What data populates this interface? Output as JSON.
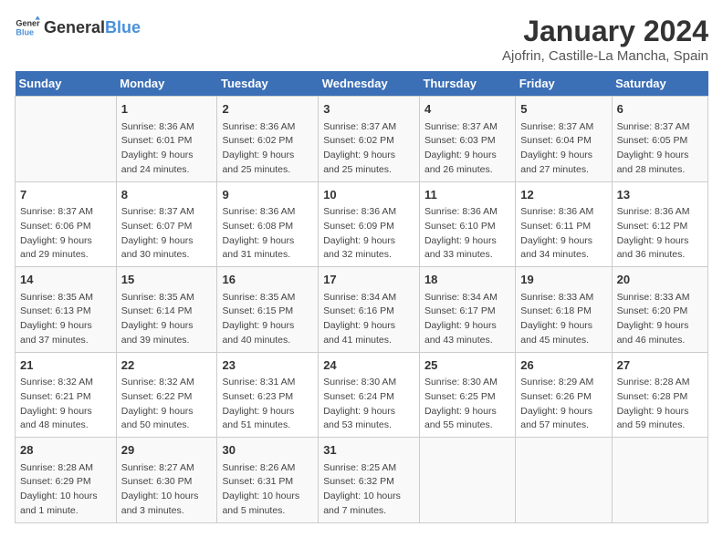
{
  "header": {
    "logo_general": "General",
    "logo_blue": "Blue",
    "title": "January 2024",
    "subtitle": "Ajofrin, Castille-La Mancha, Spain"
  },
  "columns": [
    "Sunday",
    "Monday",
    "Tuesday",
    "Wednesday",
    "Thursday",
    "Friday",
    "Saturday"
  ],
  "weeks": [
    [
      {
        "day": "",
        "lines": []
      },
      {
        "day": "1",
        "lines": [
          "Sunrise: 8:36 AM",
          "Sunset: 6:01 PM",
          "Daylight: 9 hours",
          "and 24 minutes."
        ]
      },
      {
        "day": "2",
        "lines": [
          "Sunrise: 8:36 AM",
          "Sunset: 6:02 PM",
          "Daylight: 9 hours",
          "and 25 minutes."
        ]
      },
      {
        "day": "3",
        "lines": [
          "Sunrise: 8:37 AM",
          "Sunset: 6:02 PM",
          "Daylight: 9 hours",
          "and 25 minutes."
        ]
      },
      {
        "day": "4",
        "lines": [
          "Sunrise: 8:37 AM",
          "Sunset: 6:03 PM",
          "Daylight: 9 hours",
          "and 26 minutes."
        ]
      },
      {
        "day": "5",
        "lines": [
          "Sunrise: 8:37 AM",
          "Sunset: 6:04 PM",
          "Daylight: 9 hours",
          "and 27 minutes."
        ]
      },
      {
        "day": "6",
        "lines": [
          "Sunrise: 8:37 AM",
          "Sunset: 6:05 PM",
          "Daylight: 9 hours",
          "and 28 minutes."
        ]
      }
    ],
    [
      {
        "day": "7",
        "lines": [
          "Sunrise: 8:37 AM",
          "Sunset: 6:06 PM",
          "Daylight: 9 hours",
          "and 29 minutes."
        ]
      },
      {
        "day": "8",
        "lines": [
          "Sunrise: 8:37 AM",
          "Sunset: 6:07 PM",
          "Daylight: 9 hours",
          "and 30 minutes."
        ]
      },
      {
        "day": "9",
        "lines": [
          "Sunrise: 8:36 AM",
          "Sunset: 6:08 PM",
          "Daylight: 9 hours",
          "and 31 minutes."
        ]
      },
      {
        "day": "10",
        "lines": [
          "Sunrise: 8:36 AM",
          "Sunset: 6:09 PM",
          "Daylight: 9 hours",
          "and 32 minutes."
        ]
      },
      {
        "day": "11",
        "lines": [
          "Sunrise: 8:36 AM",
          "Sunset: 6:10 PM",
          "Daylight: 9 hours",
          "and 33 minutes."
        ]
      },
      {
        "day": "12",
        "lines": [
          "Sunrise: 8:36 AM",
          "Sunset: 6:11 PM",
          "Daylight: 9 hours",
          "and 34 minutes."
        ]
      },
      {
        "day": "13",
        "lines": [
          "Sunrise: 8:36 AM",
          "Sunset: 6:12 PM",
          "Daylight: 9 hours",
          "and 36 minutes."
        ]
      }
    ],
    [
      {
        "day": "14",
        "lines": [
          "Sunrise: 8:35 AM",
          "Sunset: 6:13 PM",
          "Daylight: 9 hours",
          "and 37 minutes."
        ]
      },
      {
        "day": "15",
        "lines": [
          "Sunrise: 8:35 AM",
          "Sunset: 6:14 PM",
          "Daylight: 9 hours",
          "and 39 minutes."
        ]
      },
      {
        "day": "16",
        "lines": [
          "Sunrise: 8:35 AM",
          "Sunset: 6:15 PM",
          "Daylight: 9 hours",
          "and 40 minutes."
        ]
      },
      {
        "day": "17",
        "lines": [
          "Sunrise: 8:34 AM",
          "Sunset: 6:16 PM",
          "Daylight: 9 hours",
          "and 41 minutes."
        ]
      },
      {
        "day": "18",
        "lines": [
          "Sunrise: 8:34 AM",
          "Sunset: 6:17 PM",
          "Daylight: 9 hours",
          "and 43 minutes."
        ]
      },
      {
        "day": "19",
        "lines": [
          "Sunrise: 8:33 AM",
          "Sunset: 6:18 PM",
          "Daylight: 9 hours",
          "and 45 minutes."
        ]
      },
      {
        "day": "20",
        "lines": [
          "Sunrise: 8:33 AM",
          "Sunset: 6:20 PM",
          "Daylight: 9 hours",
          "and 46 minutes."
        ]
      }
    ],
    [
      {
        "day": "21",
        "lines": [
          "Sunrise: 8:32 AM",
          "Sunset: 6:21 PM",
          "Daylight: 9 hours",
          "and 48 minutes."
        ]
      },
      {
        "day": "22",
        "lines": [
          "Sunrise: 8:32 AM",
          "Sunset: 6:22 PM",
          "Daylight: 9 hours",
          "and 50 minutes."
        ]
      },
      {
        "day": "23",
        "lines": [
          "Sunrise: 8:31 AM",
          "Sunset: 6:23 PM",
          "Daylight: 9 hours",
          "and 51 minutes."
        ]
      },
      {
        "day": "24",
        "lines": [
          "Sunrise: 8:30 AM",
          "Sunset: 6:24 PM",
          "Daylight: 9 hours",
          "and 53 minutes."
        ]
      },
      {
        "day": "25",
        "lines": [
          "Sunrise: 8:30 AM",
          "Sunset: 6:25 PM",
          "Daylight: 9 hours",
          "and 55 minutes."
        ]
      },
      {
        "day": "26",
        "lines": [
          "Sunrise: 8:29 AM",
          "Sunset: 6:26 PM",
          "Daylight: 9 hours",
          "and 57 minutes."
        ]
      },
      {
        "day": "27",
        "lines": [
          "Sunrise: 8:28 AM",
          "Sunset: 6:28 PM",
          "Daylight: 9 hours",
          "and 59 minutes."
        ]
      }
    ],
    [
      {
        "day": "28",
        "lines": [
          "Sunrise: 8:28 AM",
          "Sunset: 6:29 PM",
          "Daylight: 10 hours",
          "and 1 minute."
        ]
      },
      {
        "day": "29",
        "lines": [
          "Sunrise: 8:27 AM",
          "Sunset: 6:30 PM",
          "Daylight: 10 hours",
          "and 3 minutes."
        ]
      },
      {
        "day": "30",
        "lines": [
          "Sunrise: 8:26 AM",
          "Sunset: 6:31 PM",
          "Daylight: 10 hours",
          "and 5 minutes."
        ]
      },
      {
        "day": "31",
        "lines": [
          "Sunrise: 8:25 AM",
          "Sunset: 6:32 PM",
          "Daylight: 10 hours",
          "and 7 minutes."
        ]
      },
      {
        "day": "",
        "lines": []
      },
      {
        "day": "",
        "lines": []
      },
      {
        "day": "",
        "lines": []
      }
    ]
  ]
}
